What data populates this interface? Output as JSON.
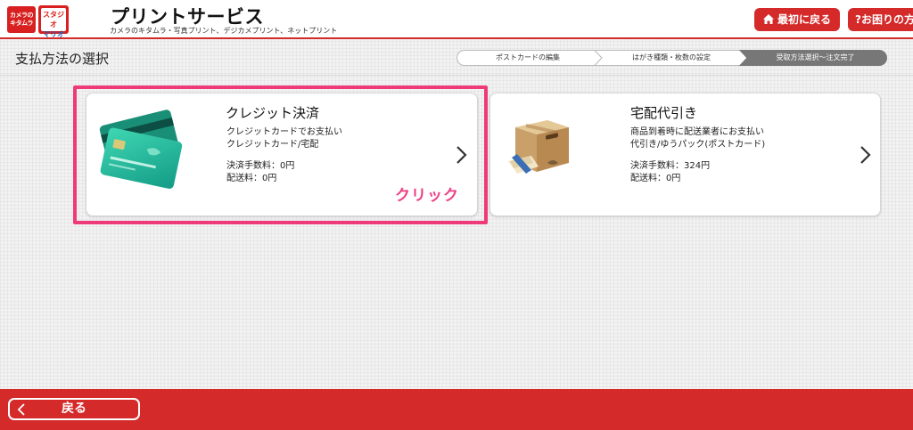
{
  "header": {
    "logo1_text": "カメラのキタムラ",
    "logo2_text_top": "スタジオ",
    "logo2_text_bottom": "マリオ",
    "title": "プリントサービス",
    "subtitle": "カメラのキタムラ・写真プリント、デジカメプリント、ネットプリント",
    "top_button": "最初に戻る",
    "help_button": "?お困りの方"
  },
  "page": {
    "title": "支払方法の選択"
  },
  "steps": [
    {
      "label": "ポストカードの編集",
      "active": false
    },
    {
      "label": "はがき種類・枚数の設定",
      "active": false
    },
    {
      "label": "受取方法選択〜注文完了",
      "active": true
    }
  ],
  "options": {
    "credit": {
      "title": "クレジット決済",
      "line1": "クレジットカードでお支払い",
      "line2": "クレジットカード/宅配",
      "fee": "決済手数料：0円",
      "shipping": "配送料：0円",
      "annotation": "クリック"
    },
    "delivery": {
      "title": "宅配代引き",
      "line1": "商品到着時に配送業者にお支払い",
      "line2": "代引き/ゆうパック(ポストカード)",
      "fee": "決済手数料：324円",
      "shipping": "配送料：0円"
    }
  },
  "footer": {
    "back_label": "戻る"
  },
  "colors": {
    "brand_red": "#d42a2a",
    "highlight_pink": "#ee3a79",
    "active_step": "#777777"
  }
}
